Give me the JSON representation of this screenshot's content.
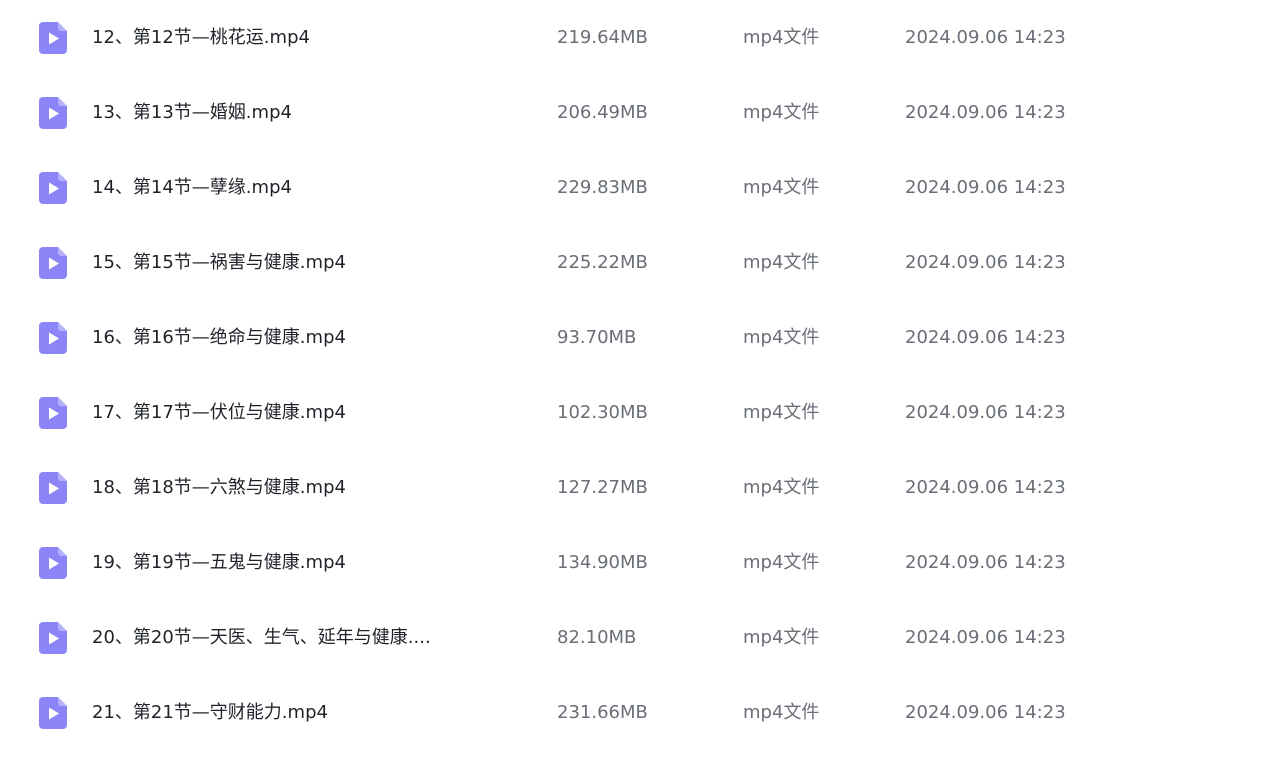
{
  "accent_color": "#8b85f7",
  "files": [
    {
      "icon": "video-file-icon",
      "name": "12、第12节—桃花运.mp4",
      "size": "219.64MB",
      "type": "mp4文件",
      "date": "2024.09.06 14:23"
    },
    {
      "icon": "video-file-icon",
      "name": "13、第13节—婚姻.mp4",
      "size": "206.49MB",
      "type": "mp4文件",
      "date": "2024.09.06 14:23"
    },
    {
      "icon": "video-file-icon",
      "name": "14、第14节—孽缘.mp4",
      "size": "229.83MB",
      "type": "mp4文件",
      "date": "2024.09.06 14:23"
    },
    {
      "icon": "video-file-icon",
      "name": "15、第15节—祸害与健康.mp4",
      "size": "225.22MB",
      "type": "mp4文件",
      "date": "2024.09.06 14:23"
    },
    {
      "icon": "video-file-icon",
      "name": "16、第16节—绝命与健康.mp4",
      "size": "93.70MB",
      "type": "mp4文件",
      "date": "2024.09.06 14:23"
    },
    {
      "icon": "video-file-icon",
      "name": "17、第17节—伏位与健康.mp4",
      "size": "102.30MB",
      "type": "mp4文件",
      "date": "2024.09.06 14:23"
    },
    {
      "icon": "video-file-icon",
      "name": "18、第18节—六煞与健康.mp4",
      "size": "127.27MB",
      "type": "mp4文件",
      "date": "2024.09.06 14:23"
    },
    {
      "icon": "video-file-icon",
      "name": "19、第19节—五鬼与健康.mp4",
      "size": "134.90MB",
      "type": "mp4文件",
      "date": "2024.09.06 14:23"
    },
    {
      "icon": "video-file-icon",
      "name": "20、第20节—天医、生气、延年与健康....",
      "size": "82.10MB",
      "type": "mp4文件",
      "date": "2024.09.06 14:23"
    },
    {
      "icon": "video-file-icon",
      "name": "21、第21节—守财能力.mp4",
      "size": "231.66MB",
      "type": "mp4文件",
      "date": "2024.09.06 14:23"
    }
  ]
}
